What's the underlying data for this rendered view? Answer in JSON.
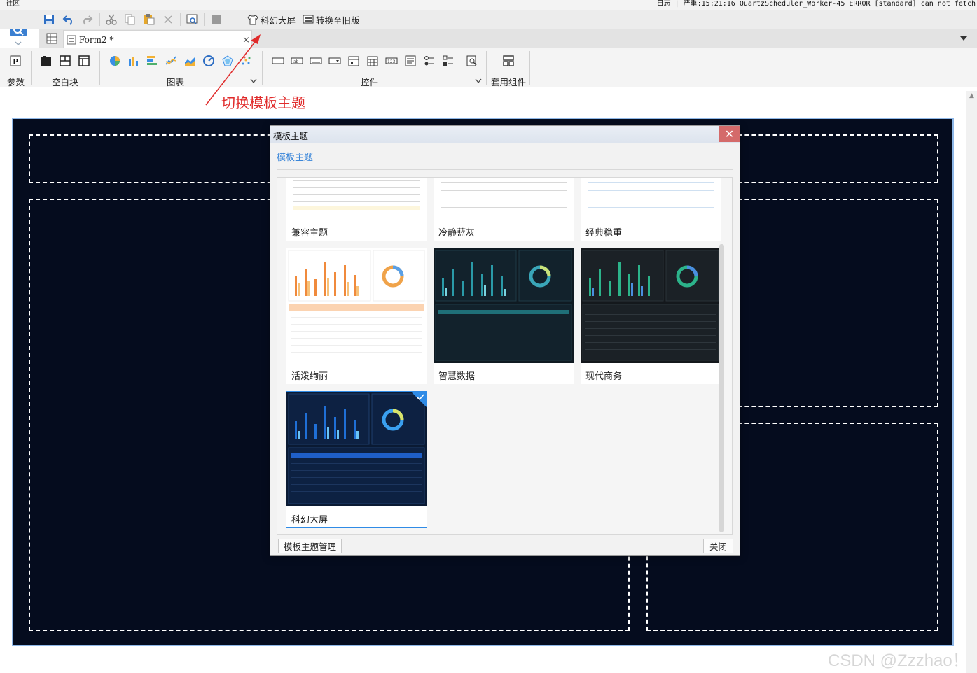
{
  "status": {
    "left": "社区",
    "right": "日志 | 严重:15:21:16 QuartzScheduler_Worker-45 ERROR [standard] can not fetch"
  },
  "toolbar": {
    "scifi_screen_label": "科幻大屏",
    "convert_old_label": "转换至旧版"
  },
  "tab": {
    "form_label": "Form2 *",
    "close_glyph": "×"
  },
  "ribbon": {
    "groups": {
      "param": "参数",
      "blank": "空白块",
      "chart": "图表",
      "control": "控件",
      "suite": "套用组件"
    }
  },
  "annotation": {
    "text": "切换模板主题"
  },
  "dialog": {
    "title": "模板主题",
    "close_glyph": "✕",
    "section_label": "模板主题",
    "themes": [
      {
        "name": "兼容主题",
        "style": "light",
        "selected": false
      },
      {
        "name": "冷静蓝灰",
        "style": "light",
        "selected": false
      },
      {
        "name": "经典稳重",
        "style": "light",
        "selected": false
      },
      {
        "name": "活泼绚丽",
        "style": "orange",
        "selected": false
      },
      {
        "name": "智慧数据",
        "style": "teal",
        "selected": false
      },
      {
        "name": "现代商务",
        "style": "green",
        "selected": false
      },
      {
        "name": "科幻大屏",
        "style": "blue",
        "selected": true
      }
    ],
    "buttons": {
      "manage": "模板主题管理",
      "close": "关闭"
    }
  },
  "watermark": "CSDN @Zzzhao！",
  "colors": {
    "canvas_bg": "#050c1e",
    "selection_blue": "#2f8be6",
    "annotation_red": "#e02b2b",
    "dialog_close": "#d46a6a"
  }
}
